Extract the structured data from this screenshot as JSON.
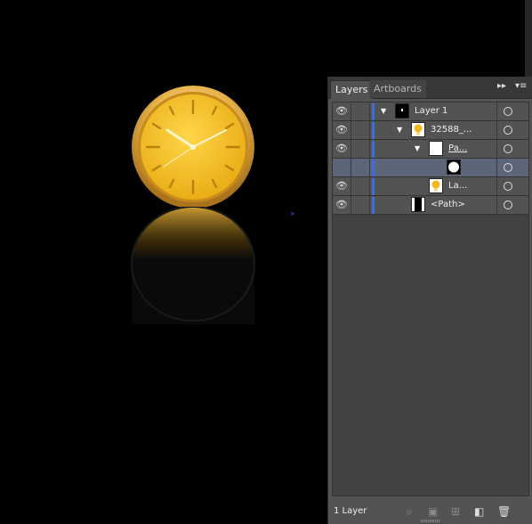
{
  "panel": {
    "tabs": [
      {
        "label": "Layers"
      },
      {
        "label": "Artboards"
      }
    ],
    "menu_icon": "panel-menu-icon",
    "collapse_icon": "double-chevron-icon"
  },
  "layers": [
    {
      "name": "Layer 1",
      "visible": true,
      "thumb": "layer-thumb",
      "expanded": true
    },
    {
      "name": "32588_...",
      "visible": true,
      "thumb": "clock-thumb",
      "expanded": true
    },
    {
      "name": "Pa...",
      "visible": true,
      "thumb": "white-thumb",
      "expanded": true
    },
    {
      "name": "",
      "visible": false,
      "thumb": "circle-thumb",
      "selected": true
    },
    {
      "name": "La...",
      "visible": true,
      "thumb": "clock-thumb"
    },
    {
      "name": "<Path>",
      "visible": true,
      "thumb": "path-thumb"
    }
  ],
  "footer": {
    "count_label": "1 Layer"
  },
  "colors": {
    "layer_color": "#3b6de0",
    "panel_bg": "#535353",
    "selected_row": "#5c6678"
  }
}
